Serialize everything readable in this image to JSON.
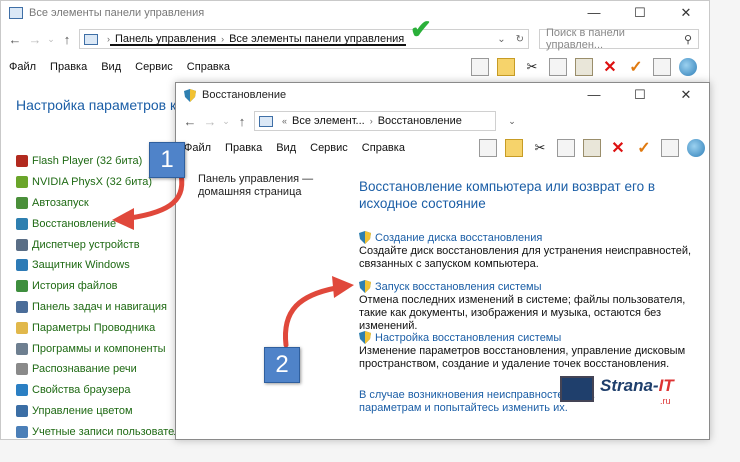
{
  "back_window": {
    "title": "Все элементы панели управления",
    "controls": [
      "—",
      "☐",
      "✕"
    ],
    "breadcrumbs": [
      "Панель управления",
      "Все элементы панели управления"
    ],
    "search_placeholder": "Поиск в панели управлен...",
    "menu": [
      "Файл",
      "Правка",
      "Вид",
      "Сервис",
      "Справка"
    ],
    "heading": "Настройка параметров ком",
    "items": [
      {
        "label": "Flash Player (32 бита)",
        "icon": "flash-icon",
        "color": "#b22a1f"
      },
      {
        "label": "NVIDIA PhysX (32 бита)",
        "icon": "nvidia-icon",
        "color": "#6aa52a"
      },
      {
        "label": "Автозапуск",
        "icon": "autoplay-icon",
        "color": "#4a8f3a"
      },
      {
        "label": "Восстановление",
        "icon": "recovery-icon",
        "color": "#2e7fb0"
      },
      {
        "label": "Диспетчер устройств",
        "icon": "device-manager-icon",
        "color": "#5a6e86"
      },
      {
        "label": "Защитник Windows",
        "icon": "defender-icon",
        "color": "#2d7bb6"
      },
      {
        "label": "История файлов",
        "icon": "file-history-icon",
        "color": "#3e8e3e"
      },
      {
        "label": "Панель задач и навигация",
        "icon": "taskbar-icon",
        "color": "#4b6d99"
      },
      {
        "label": "Параметры Проводника",
        "icon": "folder-options-icon",
        "color": "#e1b84b"
      },
      {
        "label": "Программы и компоненты",
        "icon": "programs-icon",
        "color": "#6e7f90"
      },
      {
        "label": "Распознавание речи",
        "icon": "speech-icon",
        "color": "#8a8a8a"
      },
      {
        "label": "Свойства браузера",
        "icon": "browser-icon",
        "color": "#2b7fc3"
      },
      {
        "label": "Управление цветом",
        "icon": "color-management-icon",
        "color": "#3b6ea5"
      },
      {
        "label": "Учетные записи пользователей",
        "icon": "user-accounts-icon",
        "color": "#4b7fb8"
      }
    ]
  },
  "front_window": {
    "title": "Восстановление",
    "controls": [
      "—",
      "☐",
      "✕"
    ],
    "breadcrumbs": [
      "Все элемент...",
      "Восстановление"
    ],
    "menu": [
      "Файл",
      "Правка",
      "Вид",
      "Сервис",
      "Справка"
    ],
    "left_link": "Панель управления — домашняя страница",
    "heading": "Восстановление компьютера или возврат его в исходное состояние",
    "tasks": [
      {
        "link": "Создание диска восстановления",
        "desc": "Создайте диск восстановления для устранения неисправностей, связанных с запуском компьютера."
      },
      {
        "link": "Запуск восстановления системы",
        "desc": "Отмена последних изменений в системе; файлы пользователя, такие как документы, изображения и музыка, остаются без изменений."
      },
      {
        "link": "Настройка восстановления системы",
        "desc": "Изменение параметров восстановления, управление дисковым пространством, создание и удаление точек восстановления."
      }
    ],
    "footer": "В случае возникновения неисправностей с к... параметрам и попытайтесь изменить их."
  },
  "annotations": {
    "badge_1": "1",
    "badge_2": "2",
    "arrow_color": "#e0483b",
    "badge_color": "#4f83c9",
    "check_color": "#2bb03a"
  },
  "logo": {
    "text_main": "Strana-",
    "text_accent": "IT",
    "suffix": ".ru"
  }
}
